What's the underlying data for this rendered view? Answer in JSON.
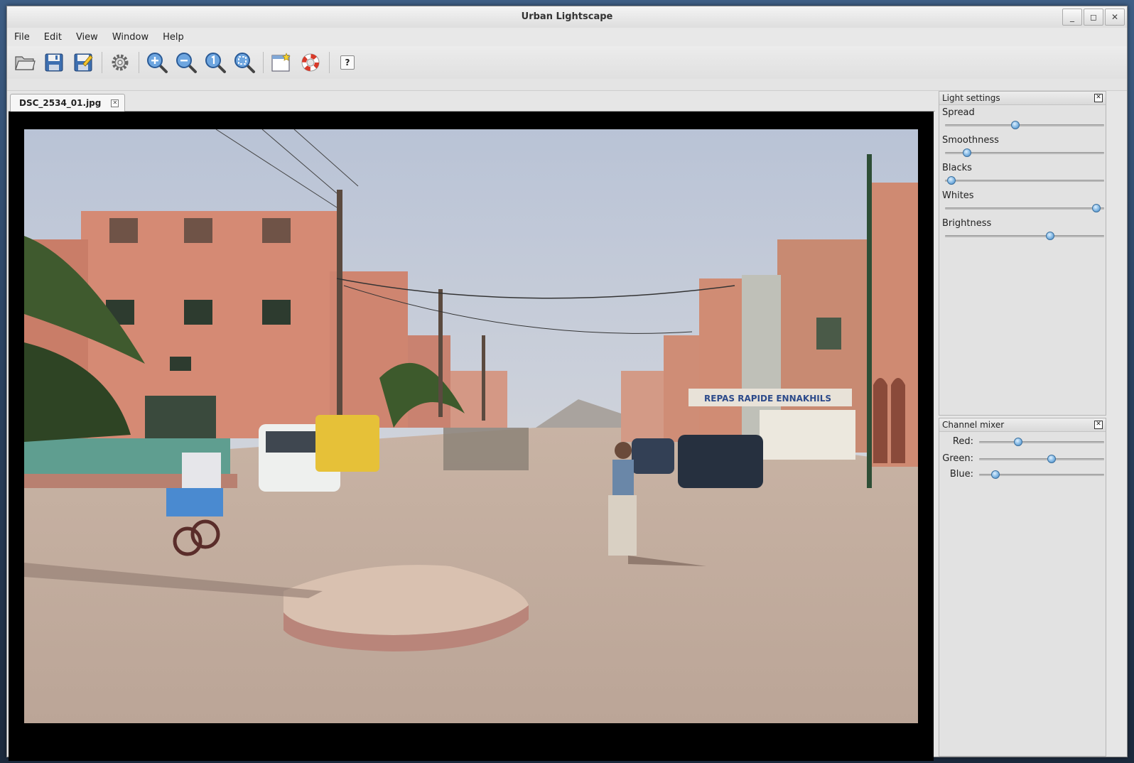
{
  "window": {
    "title": "Urban Lightscape"
  },
  "menu": [
    "File",
    "Edit",
    "View",
    "Window",
    "Help"
  ],
  "toolbar": {
    "help_label": "?"
  },
  "document": {
    "tab_label": "DSC_2534_01.jpg"
  },
  "light_settings": {
    "title": "Light settings",
    "sliders": [
      {
        "label": "Spread",
        "value": 0.44
      },
      {
        "label": "Smoothness",
        "value": 0.14
      },
      {
        "label": "Blacks",
        "value": 0.04
      },
      {
        "label": "Whites",
        "value": 0.95
      },
      {
        "label": "Brightness",
        "value": 0.66
      }
    ]
  },
  "channel_mixer": {
    "title": "Channel mixer",
    "sliders": [
      {
        "label": "Red:",
        "value": 0.31
      },
      {
        "label": "Green:",
        "value": 0.58
      },
      {
        "label": "Blue:",
        "value": 0.13
      }
    ]
  },
  "photo_signage": "REPAS RAPIDE ENNAKHILS"
}
